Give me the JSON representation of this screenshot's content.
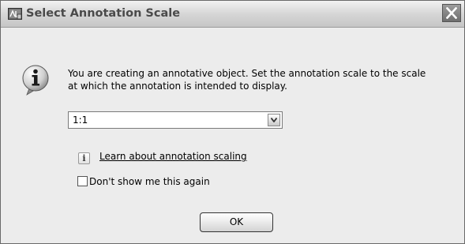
{
  "dialog": {
    "title": "Select Annotation Scale",
    "icon": "info-icon",
    "message_line1": "You are creating an annotative object.  Set the annotation scale to the scale",
    "message_line2": "at which the annotation is intended to display.",
    "scale_select": {
      "selected": "1:1"
    },
    "help_icon_glyph": "i",
    "help_link": "Learn about annotation scaling",
    "checkbox": {
      "label": "Don't show me this again",
      "checked": false
    },
    "ok_label": "OK"
  },
  "colors": {
    "titlebar_top": "#f2f2f2",
    "titlebar_bottom": "#c6c6c6",
    "body_background": "#ececec",
    "close_button": "#7a7a7a"
  }
}
